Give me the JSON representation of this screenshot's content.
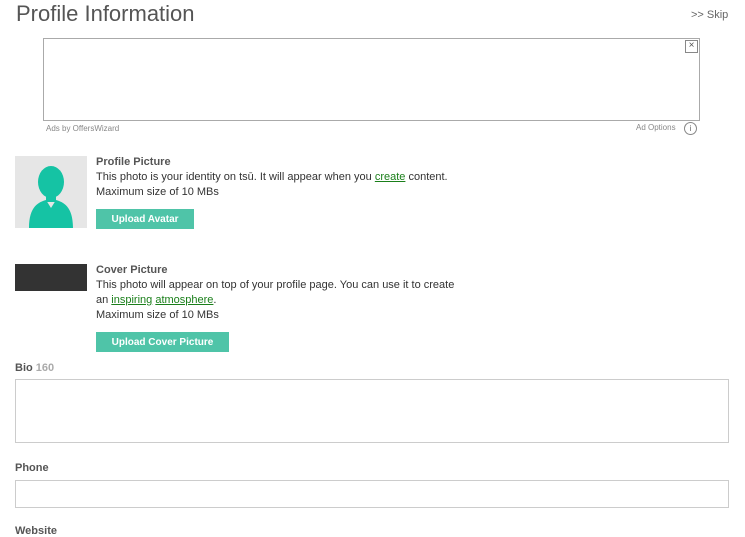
{
  "header": {
    "title": "Profile Information",
    "skip": ">> Skip"
  },
  "ad": {
    "close": "×",
    "by": "Ads by OffersWizard",
    "options": "Ad Options",
    "info": "i"
  },
  "profile_picture": {
    "heading": "Profile Picture",
    "line1_a": "This photo is your identity on tsū. It will appear when you ",
    "line1_link": "create",
    "line1_b": " content.",
    "line2": "Maximum size of 10 MBs",
    "button": "Upload Avatar"
  },
  "cover_picture": {
    "heading": "Cover Picture",
    "line1": "This photo will appear on top of your profile page. You can use it to create",
    "line2_a": "an ",
    "line2_link1": "inspiring",
    "line2_sp": " ",
    "line2_link2": "atmosphere",
    "line2_b": ".",
    "line3": "Maximum size of 10 MBs",
    "button": "Upload Cover Picture"
  },
  "bio": {
    "label": "Bio",
    "count": "160",
    "value": ""
  },
  "phone": {
    "label": "Phone",
    "value": ""
  },
  "website": {
    "label": "Website"
  },
  "colors": {
    "accent": "#4fc4a8",
    "link": "#1a7f1a"
  }
}
